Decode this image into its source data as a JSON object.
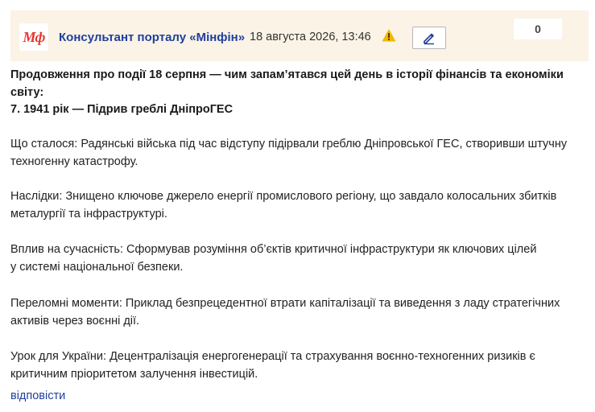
{
  "header": {
    "logo_text": "Мф",
    "author": "Консультант порталу «Мінфін»",
    "date": "18 августа 2026, 13:46",
    "counter": "0",
    "colors": {
      "background": "#faf3e6",
      "author": "#1f3f9c",
      "logo": "#e8362e",
      "warning": "#f2b705"
    },
    "icons": {
      "warning": "warning-icon",
      "edit": "pencil-icon"
    }
  },
  "post": {
    "intro": "Продовження про події 18 серпня — чим запам’ятався цей день в історії фінансів та економіки світу:",
    "heading": "7. 1941 рік — Підрив греблі ДніпроГЕС",
    "what_happened": [
      "Що сталося: Радянські війська під час відступу підірвали греблю Дніпровської ГЕС, створивши штучну",
      "техногенну катастрофу."
    ],
    "consequences": [
      "Наслідки: Знищено ключове джерело енергії промислового регіону, що завдало колосальних збитків",
      "металургії та інфраструктурі."
    ],
    "impact": [
      "Вплив на сучасність: Сформував розуміння об’єктів критичної інфраструктури як ключових цілей",
      "у системі національної безпеки."
    ],
    "turning_points": [
      "Переломні моменти: Приклад безпрецедентної втрати капіталізації та виведення з ладу стратегічних",
      "активів через воєнні дії."
    ],
    "lesson": [
      "Урок для України: Децентралізація енергогенерації та страхування воєнно-техногенних ризиків є",
      "критичним пріоритетом залучення інвестицій."
    ]
  },
  "actions": {
    "reply": "відповісти"
  }
}
